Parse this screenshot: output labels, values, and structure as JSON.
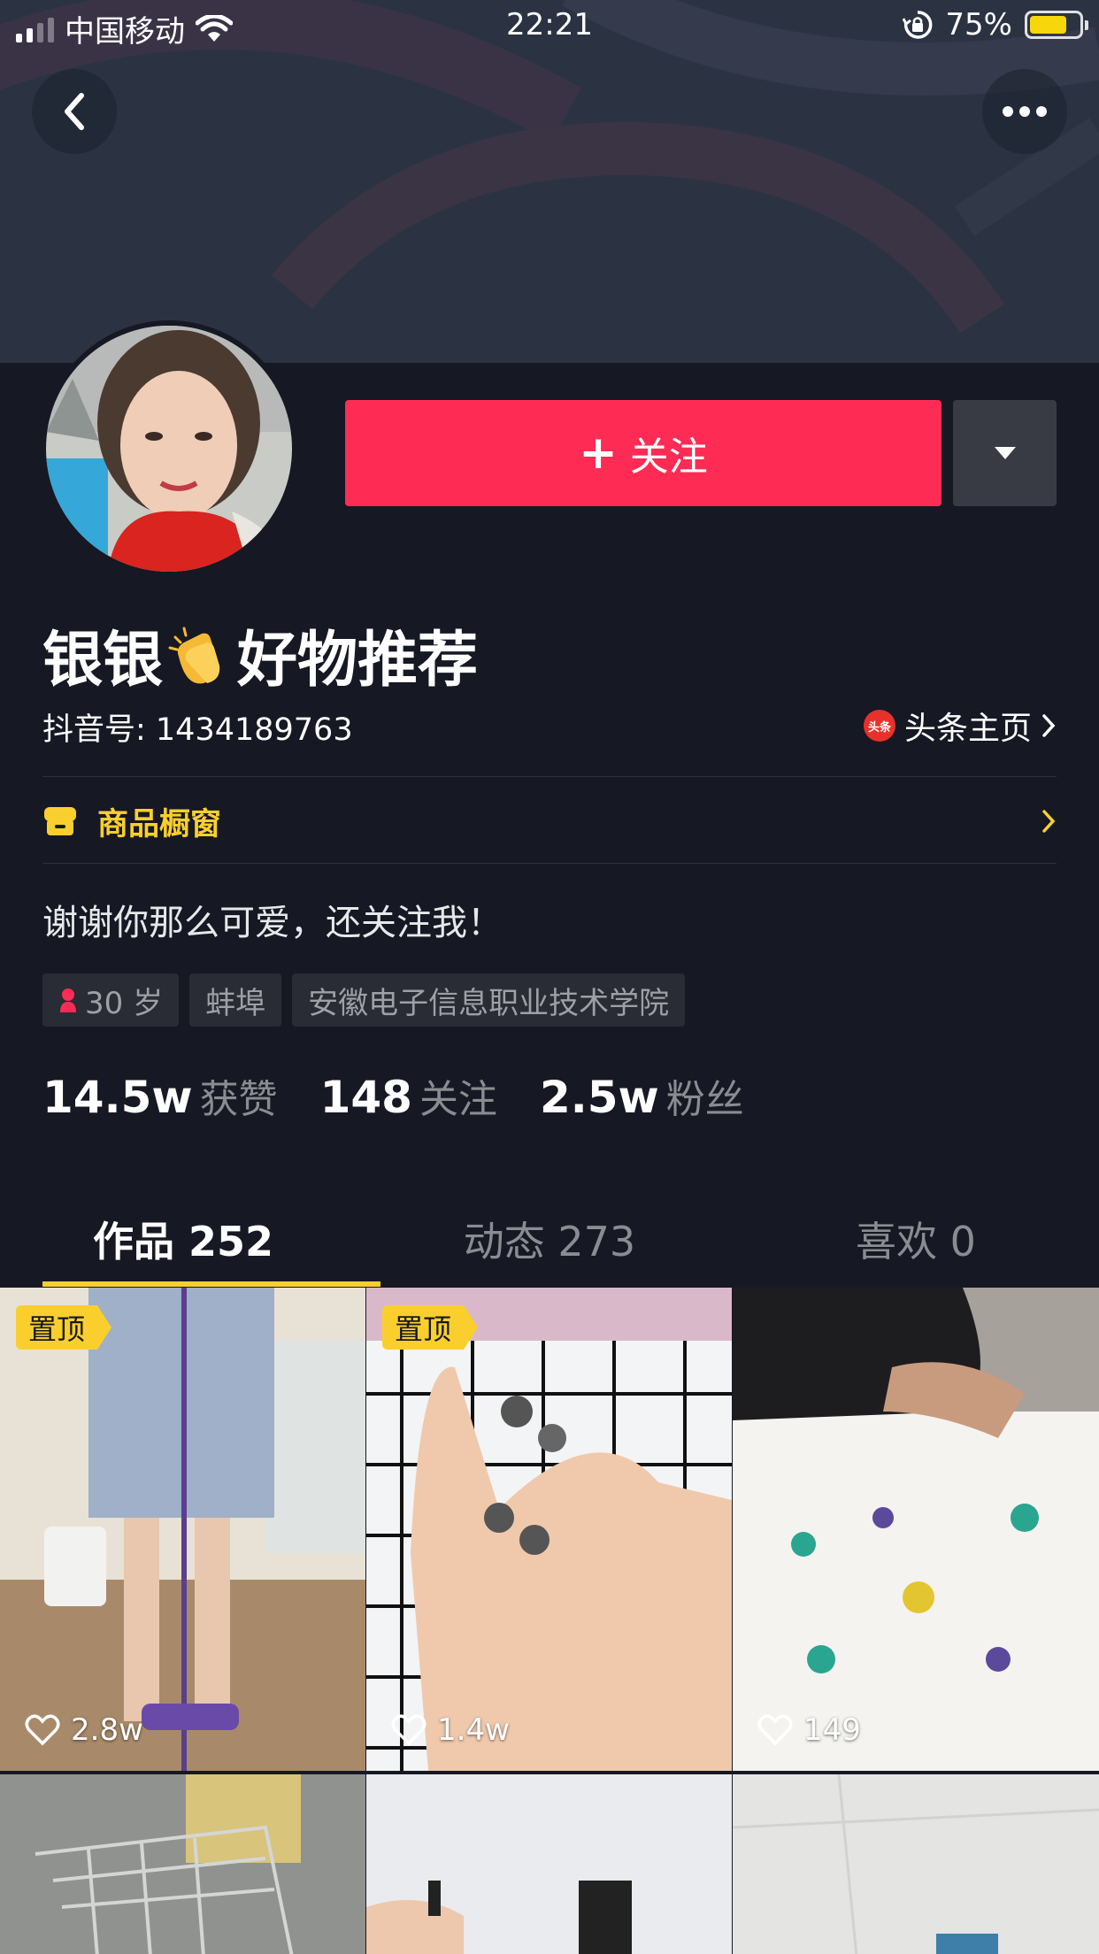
{
  "status_bar": {
    "carrier": "中国移动",
    "time": "22:21",
    "battery_percent": "75%",
    "battery_level": 0.75
  },
  "header": {
    "back_icon": "chevron-left-icon",
    "more_icon": "more-dots-icon"
  },
  "profile": {
    "follow_label": "关注",
    "username_part1": "银银",
    "username_part2": "好物推荐",
    "douyin_id": "抖音号: 1434189763",
    "toutiao_badge": "头条",
    "toutiao_label": "头条主页",
    "shop_label": "商品橱窗",
    "bio": "谢谢你那么可爱，还关注我！",
    "tags": [
      "30 岁",
      "蚌埠",
      "安徽电子信息职业技术学院"
    ],
    "stats": [
      {
        "value": "14.5w",
        "label": "获赞"
      },
      {
        "value": "148",
        "label": "关注"
      },
      {
        "value": "2.5w",
        "label": "粉丝"
      }
    ]
  },
  "tabs": [
    {
      "label": "作品 252",
      "active": true
    },
    {
      "label": "动态 273",
      "active": false
    },
    {
      "label": "喜欢 0",
      "active": false
    }
  ],
  "videos": [
    {
      "pinned_label": "置顶",
      "likes": "2.8w"
    },
    {
      "pinned_label": "置顶",
      "likes": "1.4w"
    },
    {
      "pinned_label": "",
      "likes": "149"
    }
  ],
  "colors": {
    "background": "#161823",
    "follow": "#fe2c55",
    "accent": "#facf2d"
  }
}
